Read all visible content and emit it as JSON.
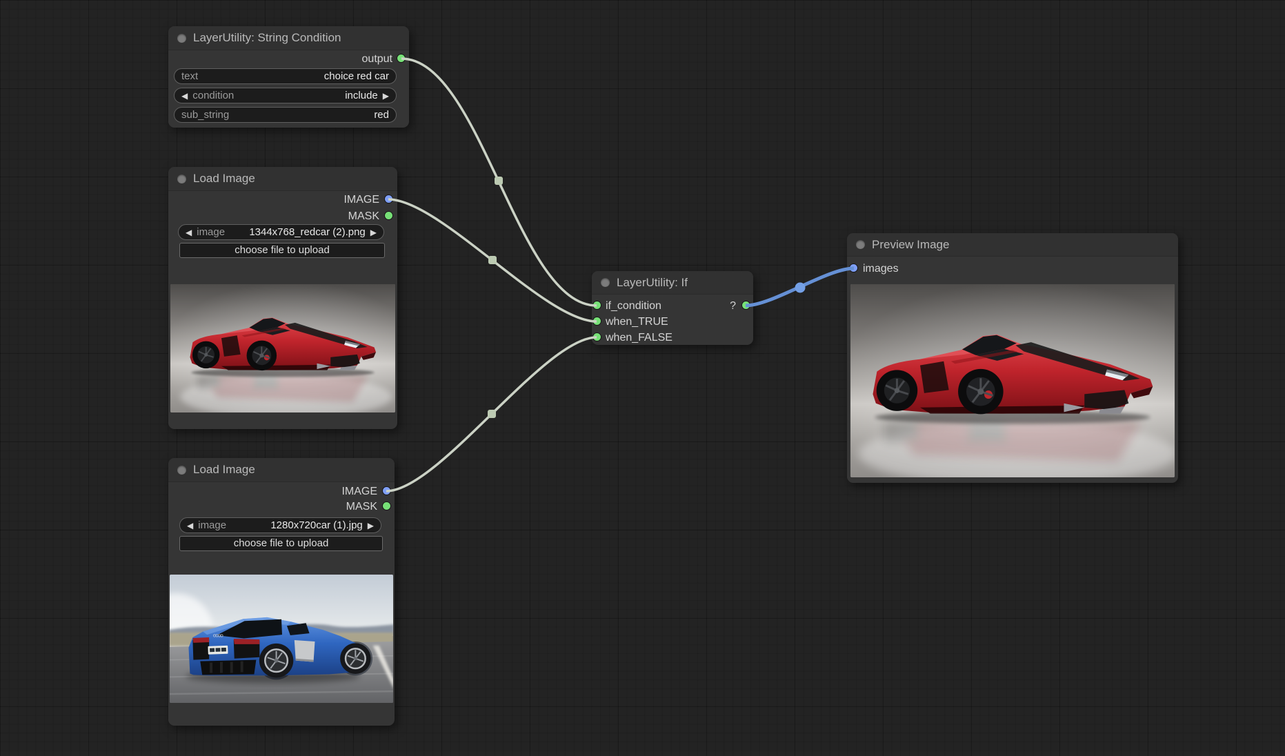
{
  "colors": {
    "canvas_bg": "#232323",
    "node_bg": "#353535",
    "link_gray": "#cbd2c5",
    "link_dot_gray": "#bccab2",
    "link_blue": "#6590d5",
    "link_dot_blue": "#74a0e6",
    "port_green": "#77e077",
    "port_blue": "#7f9ff7"
  },
  "nodes": {
    "string_condition": {
      "title": "LayerUtility: String Condition",
      "outputs": [
        {
          "label": "output"
        }
      ],
      "widgets": [
        {
          "label": "text",
          "value": "choice red car"
        },
        {
          "label": "condition",
          "value": "include"
        },
        {
          "label": "sub_string",
          "value": "red"
        }
      ]
    },
    "load_image_top": {
      "title": "Load Image",
      "outputs": [
        {
          "label": "IMAGE"
        },
        {
          "label": "MASK"
        }
      ],
      "image_widget": {
        "label": "image",
        "value": "1344x768_redcar (2).png"
      },
      "upload_button": "choose file to upload",
      "preview_alt": "red sports car in gray studio"
    },
    "load_image_bottom": {
      "title": "Load Image",
      "outputs": [
        {
          "label": "IMAGE"
        },
        {
          "label": "MASK"
        }
      ],
      "image_widget": {
        "label": "image",
        "value": "1280x720car (1).jpg"
      },
      "upload_button": "choose file to upload",
      "preview_alt": "blue sports car driving on road"
    },
    "if_node": {
      "title": "LayerUtility: If",
      "inputs": [
        {
          "label": "if_condition"
        },
        {
          "label": "when_TRUE"
        },
        {
          "label": "when_FALSE"
        }
      ],
      "outputs": [
        {
          "label": "?"
        }
      ]
    },
    "preview_image": {
      "title": "Preview Image",
      "inputs": [
        {
          "label": "images"
        }
      ],
      "preview_alt": "red sports car in gray studio"
    }
  }
}
